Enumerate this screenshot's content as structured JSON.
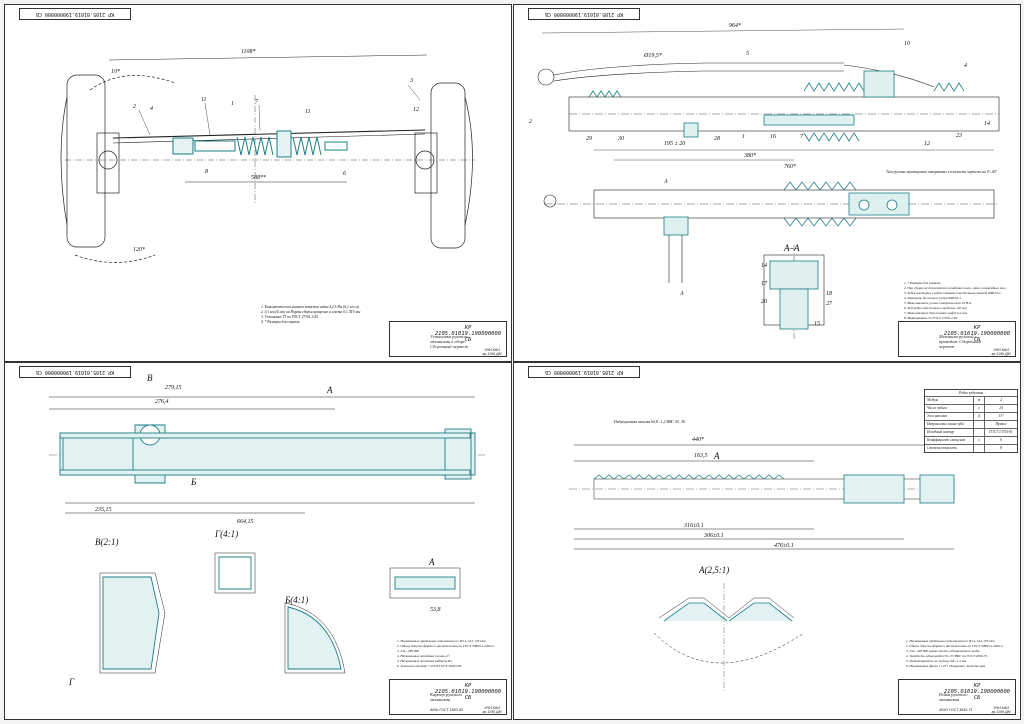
{
  "sheets": [
    {
      "code_top": "КР 2105.01019.190000000 СБ",
      "stamp_code": "КР 2105.01019.190000000 СБ",
      "stamp_title": "Установка рулевого механизма в сборе. Сборочный чертеж",
      "stamp_org": "УНИ КАИ гр.1190 ДМ",
      "notes": [
        "1. Кинематический момент затяжки гайки 4,2 5 Нм (6,1 кгс.м).",
        "2. 0,1 мм (4 мм) на Нормы сборки вращение и смазка 0,1 ЛГ0 мм",
        "3. Установка ТТ по ГОСТ 27301.2-82",
        "4. * Размеры для справок."
      ],
      "callouts": [
        "1",
        "2",
        "3",
        "4",
        "5",
        "6",
        "8",
        "10",
        "11",
        "12"
      ],
      "dims": [
        "1108*",
        "588**",
        "120*",
        "10*"
      ]
    },
    {
      "code_top": "КР 2105.01019.190000000 СБ",
      "stamp_code": "КР 2105.01019.190000000 СБ",
      "stamp_title": "Механизм рулевой с приводом. Сборочный чертеж",
      "stamp_org": "УНИ КАИ гр.1190 ДМ",
      "notes": [
        "1. * Размеры для справок.",
        "2. При сборке не допускается попадание пыли, грязи и инородных тел.",
        "3. Зубья шестерни и рейки смазать пластичным смазкой ФИОЛ-1.",
        "4. Затянуть до полного упора ФИОЛ-1.",
        "5. Максимальное усилие поворота вала 16 Н·м.",
        "6. Ход рейки обеспечить в пределах 120 мм.",
        "7. Максимальное допустимое люфт 0,2 мм.",
        "8. Маркировать по ГОСТ 27301.2-82"
      ],
      "section_label": "А–А",
      "view_label": "А",
      "leader_note": "Тяги рулевых трапециевых поворотных в плоскости чертежа на 0°–40°",
      "callouts": [
        "1",
        "2",
        "4",
        "7",
        "10",
        "12",
        "14",
        "16",
        "17",
        "18",
        "20",
        "23",
        "24",
        "25",
        "26",
        "27",
        "28",
        "29",
        "30"
      ],
      "dims": [
        "964*",
        "720*",
        "760*",
        "120*",
        "380*",
        "195 ± 20"
      ]
    },
    {
      "code_top": "КР 2105.01019.190000000 СБ",
      "stamp_code": "КР 2105.01019.190000000 СБ",
      "stamp_title": "Картер рулевого механизма",
      "stamp_gost": "АК9ч ГОСТ 1583-93",
      "stamp_org": "УНИ КАИ гр.1190 ДМ",
      "notes": [
        "1. Неуказанные предельные отклонения по IT14, h14, ±IT14/2.",
        "2. Общие допуски формы и расположения по ГОСТ 30893.2-2002-k.",
        "3. 241...285 НВ.",
        "4. Неуказанные литейные уклоны 2°.",
        "5. Неуказанные литейные радиусы R1.",
        "6. Точность отливки 7-0-0-8 ГОСТ 26645-85."
      ],
      "view_labels": [
        "В",
        "А",
        "Б",
        "Г",
        "В(2:1)",
        "Г(4:1)",
        "Б(4:1)",
        "А"
      ],
      "dims": [
        "664,15",
        "279,15",
        "276,4",
        "235,15",
        "53,8"
      ]
    },
    {
      "code_top": "КР 2105.01019.190000000 СБ",
      "stamp_code": "КР 2105.01019.190000000 СБ",
      "stamp_title": "Рейка рулевого механизма",
      "stamp_gost": "40ХН ГОСТ 4543-71",
      "stamp_org": "УНИ КАИ гр.1190 ДМ",
      "notes": [
        "1. Неуказанные предельные отклонения по IT14, h14, ±IT14/2.",
        "2. Общие допуски формы и расположения по ГОСТ 30893.2-2002-k.",
        "3. 252...285 НВ, кроме места, обозначенного особо.",
        "4. Твердость зубьев рейки 50...55 HRC по ГОСТ 2999-75.",
        "5. Цементировать на глубину 0,8...1,2 мм.",
        "6. Неуказанные фаски 1×45°. Покрытие: Хим.Окс.прм."
      ],
      "view_labels": [
        "А",
        "А(2,5:1)"
      ],
      "rack_note": "Индукционная закалка h0,8...1,2 НВС 50...56",
      "table": {
        "title": "Рейка зубчатая",
        "rows": [
          [
            "Модуль",
            "m",
            "2"
          ],
          [
            "Число зубьев",
            "z",
            "24"
          ],
          [
            "Угол наклона",
            "β",
            "13°"
          ],
          [
            "Направление линии зуба",
            "",
            "Правое"
          ],
          [
            "Исходный контур",
            "",
            "ГОСТ 13755-81"
          ],
          [
            "Коэффициент смещения",
            "x",
            "0"
          ],
          [
            "Степень точности",
            "",
            "8"
          ]
        ]
      },
      "dims": [
        "440*",
        "163,5",
        "316±0.1",
        "476±0.1",
        "306±0.1"
      ]
    }
  ],
  "colors": {
    "line": "#222222",
    "teal": "#1b7f86",
    "hatch": "#2a8f95"
  }
}
